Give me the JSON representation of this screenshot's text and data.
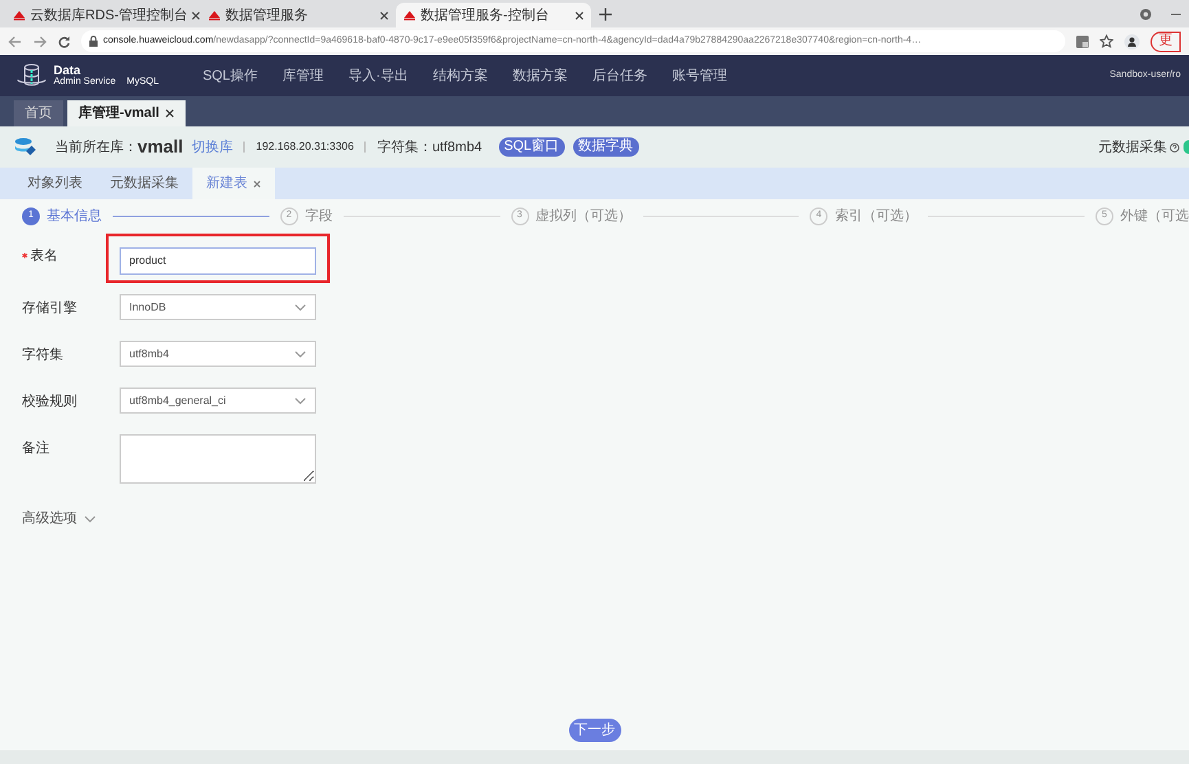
{
  "browser": {
    "tabs": [
      {
        "title": "云数据库RDS-管理控制台",
        "selected": false
      },
      {
        "title": "数据管理服务",
        "selected": false
      },
      {
        "title": "数据管理服务-控制台",
        "selected": true
      }
    ],
    "url_host": "console.huaweicloud.com",
    "url_path": "/newdasapp/?connectId=9a469618-baf0-4870-9c17-e9ee05f359f6&projectName=cn-north-4&agencyId=dad4a79b27884290aa2267218e307740&region=cn-north-4…",
    "update_button": "更"
  },
  "nav": {
    "logo_title": "Data",
    "logo_subtitle": "Admin Service",
    "engine": "MySQL",
    "menu": [
      "SQL操作",
      "库管理",
      "导入·导出",
      "结构方案",
      "数据方案",
      "后台任务",
      "账号管理"
    ],
    "user": "Sandbox-user/ro"
  },
  "page_tabs": [
    {
      "label": "首页",
      "selected": false,
      "closable": false
    },
    {
      "label": "库管理-vmall",
      "selected": true,
      "closable": true
    }
  ],
  "header": {
    "db_label": "当前所在库：",
    "db_name": "vmall",
    "switch_link": "切换库",
    "address": "192.168.20.31:3306",
    "charset": "字符集：utf8mb4",
    "buttons": [
      "SQL窗口",
      "数据字典"
    ],
    "metadata_label": "元数据采集",
    "metadata_on": true
  },
  "subtabs": [
    {
      "label": "对象列表",
      "selected": false,
      "closable": false
    },
    {
      "label": "元数据采集",
      "selected": false,
      "closable": false
    },
    {
      "label": "新建表",
      "selected": true,
      "closable": true
    }
  ],
  "steps": [
    {
      "number": "1",
      "label": "基本信息",
      "selected": true
    },
    {
      "number": "2",
      "label": "字段",
      "selected": false
    },
    {
      "number": "3",
      "label": "虚拟列（可选）",
      "selected": false
    },
    {
      "number": "4",
      "label": "索引（可选）",
      "selected": false
    },
    {
      "number": "5",
      "label": "外键（可选",
      "selected": false
    }
  ],
  "fields": [
    {
      "kind": "input",
      "label": "表名",
      "required": true,
      "value": "product",
      "highlighted": true
    },
    {
      "kind": "select",
      "label": "存储引擎",
      "required": false,
      "value": "InnoDB",
      "highlighted": false
    },
    {
      "kind": "select",
      "label": "字符集",
      "required": false,
      "value": "utf8mb4",
      "highlighted": false
    },
    {
      "kind": "select",
      "label": "校验规则",
      "required": false,
      "value": "utf8mb4_general_ci",
      "highlighted": false
    },
    {
      "kind": "textarea",
      "label": "备注",
      "required": false,
      "highlighted": false
    }
  ],
  "advanced": "高级选项",
  "next_button": "下一步"
}
